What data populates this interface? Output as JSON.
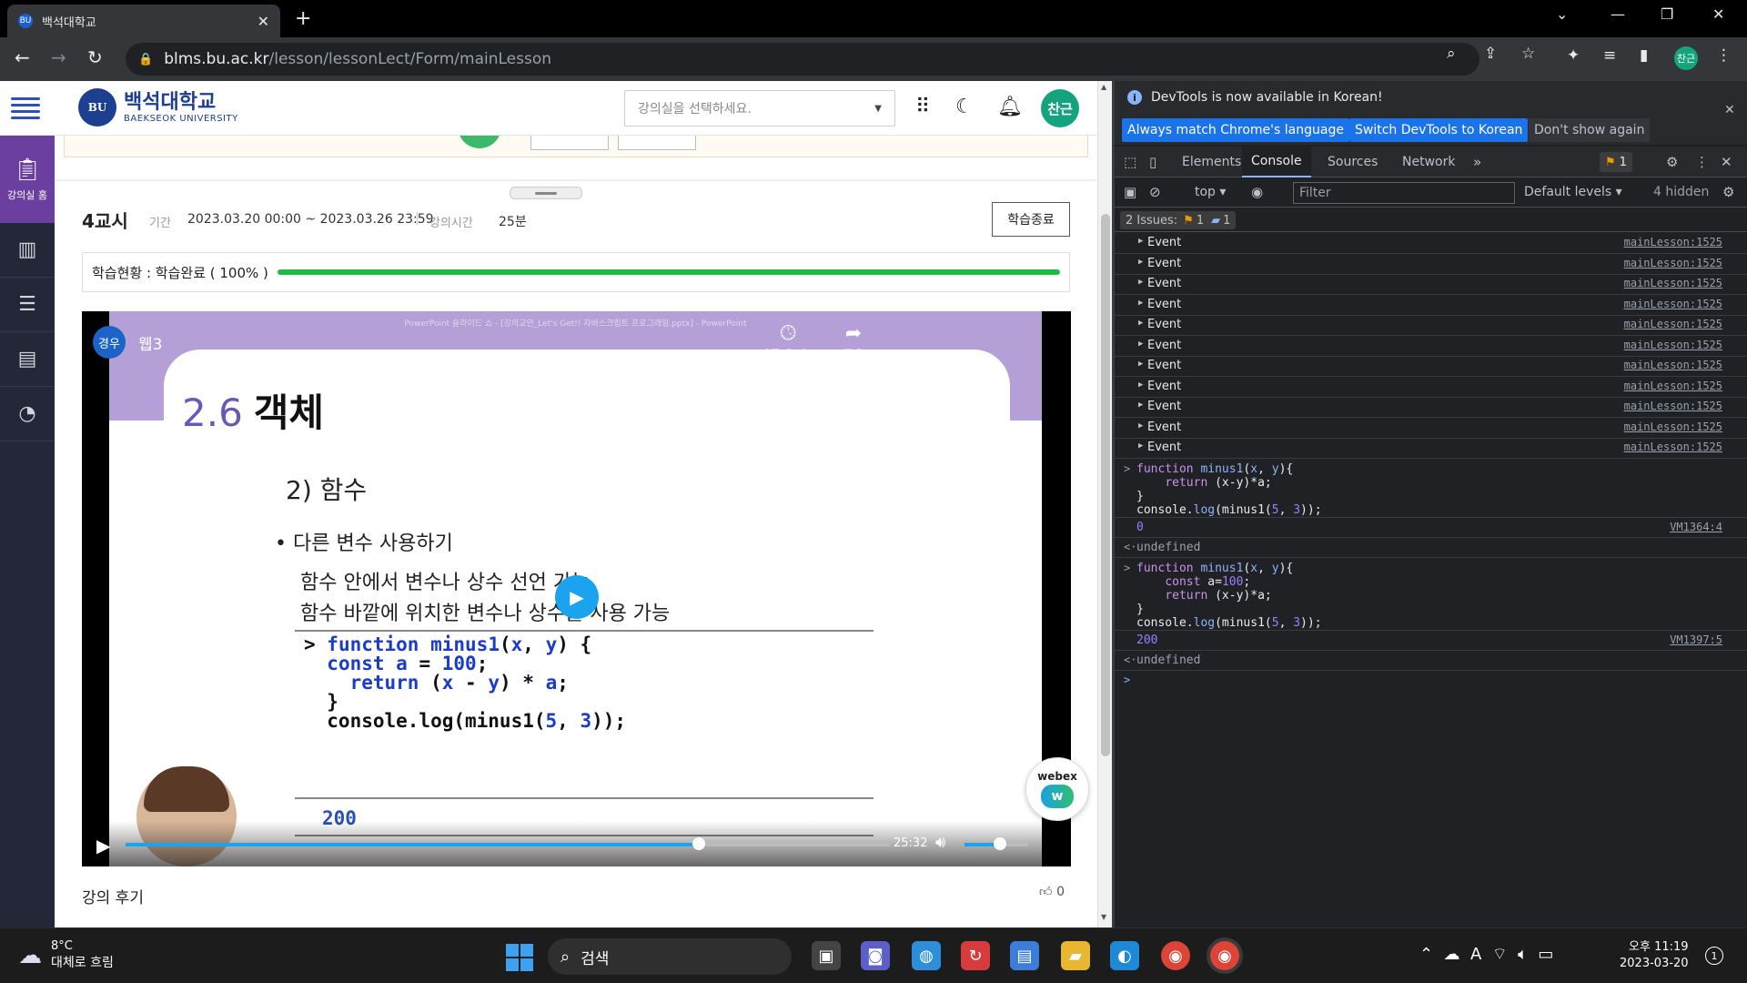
{
  "browser": {
    "tab_title": "백석대학교",
    "tab_favicon": "BU",
    "url_host": "blms.bu.ac.kr",
    "url_path": "/lesson/lessonLect/Form/mainLesson",
    "profile_initial": "찬근"
  },
  "site": {
    "logo_ko": "백석대학교",
    "logo_en": "BAEKSEOK UNIVERSITY",
    "logo_emblem": "BU",
    "course_select_placeholder": "강의실을 선택하세요.",
    "user_initial": "찬근",
    "rail_home_label": "강의실 홈"
  },
  "lesson": {
    "period": "4교시",
    "period_label": "기간",
    "period_value": "2023.03.20 00:00 ~ 2023.03.26 23:59",
    "duration_label": "강의시간",
    "duration_value": "25분",
    "end_button": "학습종료",
    "progress_label": "학습현황 : 학습완료 ( 100% )",
    "progress_percent": 100
  },
  "video": {
    "channel_initial": "경우",
    "title": "웹3",
    "watch_later": "나중에 시...",
    "share": "공유",
    "time": "25:32",
    "seek_fraction": 0.75,
    "volume_fraction": 0.55,
    "slide": {
      "window_title": "PowerPoint 슬라이드 쇼 - [강의교안_Let's Get!! 자바스크립트 프로그래밍.pptx] - PowerPoint",
      "section_number": "2.6",
      "section_title": "객체",
      "subheading": "2) 함수",
      "bullet": "• 다른 변수 사용하기",
      "line1": "함수 안에서 변수나 상수 선언 가능",
      "line2": "함수 바깥에 위치한 변수나 상수를 사용 가능",
      "output": "200"
    }
  },
  "review": {
    "title": "강의 후기",
    "likes": "0"
  },
  "webex": {
    "label": "webex"
  },
  "devtools": {
    "banner_message": "DevTools is now available in Korean!",
    "btn_match": "Always match Chrome's language",
    "btn_switch": "Switch DevTools to Korean",
    "btn_dont_show": "Don't show again",
    "tabs": [
      "Elements",
      "Console",
      "Sources",
      "Network"
    ],
    "issue_count": "1",
    "context": "top",
    "filter_placeholder": "Filter",
    "levels": "Default levels",
    "hidden": "4 hidden",
    "issues_label": "2 Issues:",
    "issues_warn": "1",
    "issues_info": "1",
    "event_label": "Event",
    "event_source": "mainLesson:1525",
    "event_count": 11,
    "result1": "0",
    "result1_source": "VM1364:4",
    "result2": "200",
    "result2_source": "VM1397:5",
    "undefined": "undefined"
  },
  "taskbar": {
    "temperature": "8°C",
    "condition": "대체로 흐림",
    "search_label": "검색",
    "time": "오후 11:19",
    "date": "2023-03-20",
    "notifications": "1"
  },
  "colors": {
    "accent_blue": "#1ca3f0",
    "progress_green": "#1ebc43",
    "brand_navy": "#1d3f8f",
    "avatar_green": "#14a37c"
  }
}
